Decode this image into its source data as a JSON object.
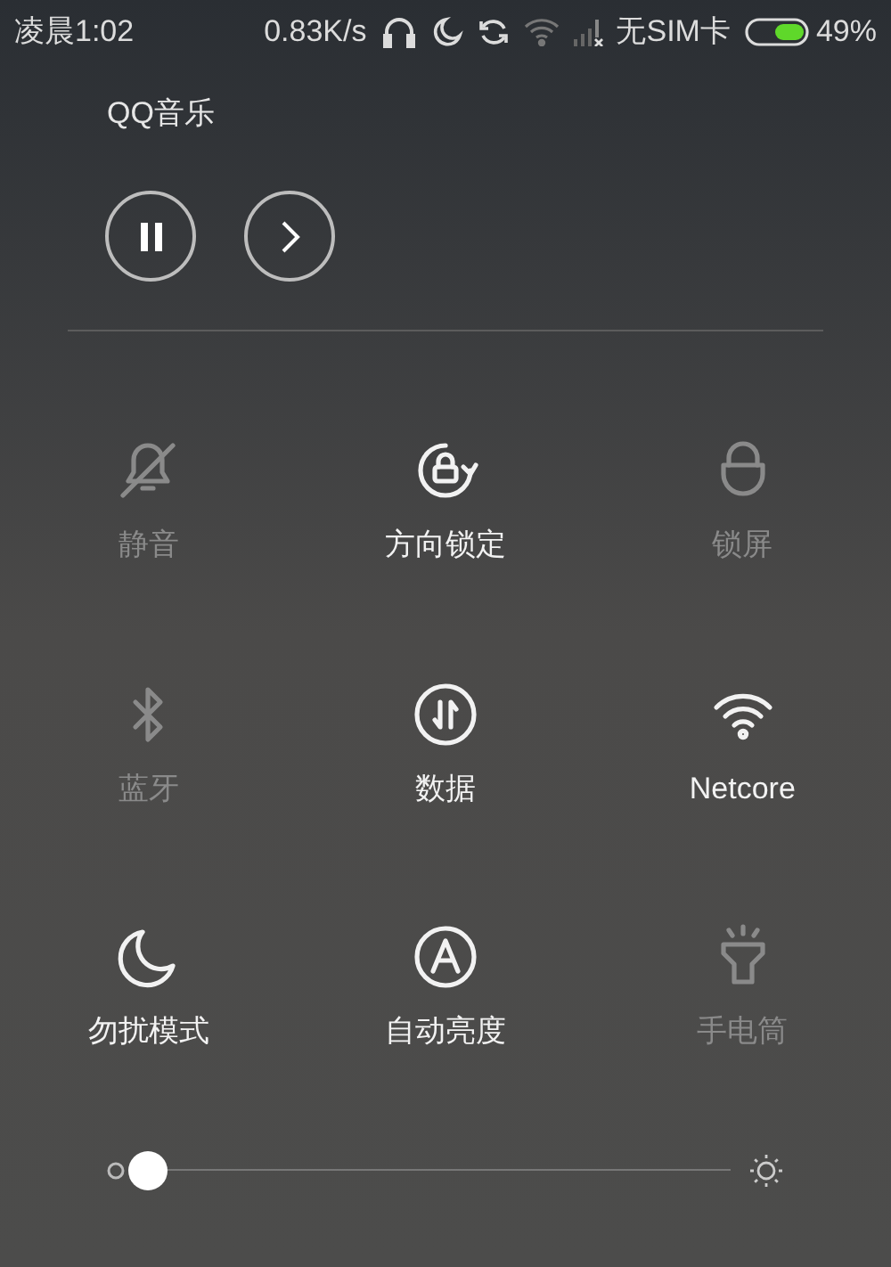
{
  "status_bar": {
    "time": "凌晨1:02",
    "speed": "0.83K/s",
    "sim": "无SIM卡",
    "battery": "49%"
  },
  "music": {
    "app": "QQ音乐"
  },
  "toggles": [
    {
      "kind": "mute",
      "label": "静音",
      "on": false
    },
    {
      "kind": "rotation",
      "label": "方向锁定",
      "on": true
    },
    {
      "kind": "lock",
      "label": "锁屏",
      "on": false
    },
    {
      "kind": "bluetooth",
      "label": "蓝牙",
      "on": false
    },
    {
      "kind": "data",
      "label": "数据",
      "on": true
    },
    {
      "kind": "wifi",
      "label": "Netcore",
      "on": true
    },
    {
      "kind": "dnd",
      "label": "勿扰模式",
      "on": true
    },
    {
      "kind": "auto",
      "label": "自动亮度",
      "on": true
    },
    {
      "kind": "torch",
      "label": "手电筒",
      "on": false
    }
  ],
  "brightness": {
    "level": 0
  }
}
